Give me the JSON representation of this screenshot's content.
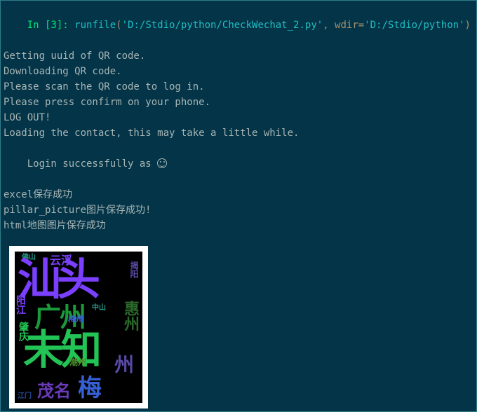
{
  "prompt": {
    "label": "In [3]: ",
    "call": "runfile",
    "open": "(",
    "arg1": "'D:/Stdio/python/CheckWechat_2.py'",
    "sep": ", ",
    "kwarg": "wdir",
    "eq": "=",
    "arg2": "'D:/Stdio/python'",
    "close": ")"
  },
  "out": {
    "l1": "Getting uuid of QR code.",
    "l2": "Downloading QR code.",
    "l3": "Please scan the QR code to log in.",
    "l4": "Please press confirm on your phone.",
    "l5": "LOG OUT!",
    "l6": "Loading the contact, this may take a little while.",
    "l7a": "Login successfully as ",
    "l8": "excel保存成功",
    "l9": "pillar_picture图片保存成功!",
    "l10": "html地图图片保存成功"
  },
  "wc": {
    "yunfu": "云浮",
    "shantou": "汕头",
    "guangzhou": "广州",
    "weizhi": "未知",
    "zhou": "州",
    "maoming": "茂名",
    "mei": "梅",
    "chaozhou": "潮州",
    "zhongshan": "中山",
    "vert_jieyang": "揭阳",
    "vert_yangjiang": "阳江",
    "vert_zhaoqing": "肇庆",
    "vert_huizhou": "惠州",
    "small_fs": "佛山",
    "jiangmen": "江门",
    "xz": "梅州"
  }
}
